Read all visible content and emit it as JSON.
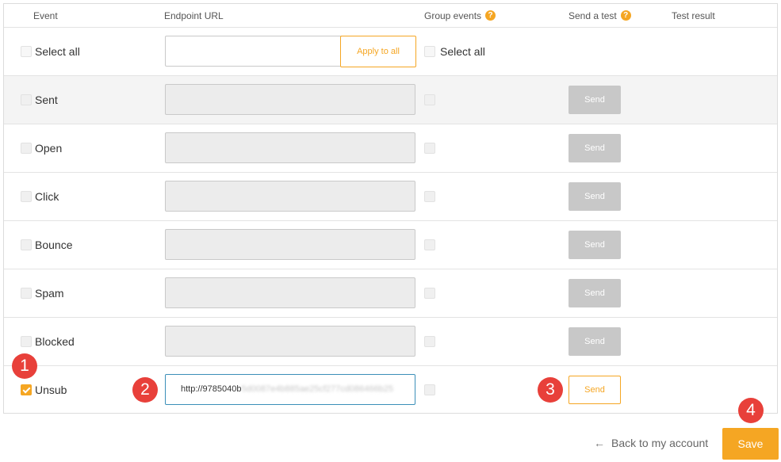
{
  "header": {
    "event": "Event",
    "endpoint_url": "Endpoint URL",
    "group_events": "Group events",
    "send_test": "Send a test",
    "test_result": "Test result",
    "help_glyph": "?"
  },
  "select_all_row": {
    "label": "Select all",
    "url_value": "",
    "apply_label": "Apply to all",
    "group_label": "Select all"
  },
  "rows": [
    {
      "label": "Sent",
      "checked": false,
      "url": "",
      "send_label": "Send"
    },
    {
      "label": "Open",
      "checked": false,
      "url": "",
      "send_label": "Send"
    },
    {
      "label": "Click",
      "checked": false,
      "url": "",
      "send_label": "Send"
    },
    {
      "label": "Bounce",
      "checked": false,
      "url": "",
      "send_label": "Send"
    },
    {
      "label": "Spam",
      "checked": false,
      "url": "",
      "send_label": "Send"
    },
    {
      "label": "Blocked",
      "checked": false,
      "url": "",
      "send_label": "Send"
    },
    {
      "label": "Unsub",
      "checked": true,
      "url_visible": "http://9785040b",
      "url_obscured": "5d0087e4b885ae25cf277cd086466b25",
      "send_label": "Send"
    }
  ],
  "markers": [
    "1",
    "2",
    "3",
    "4"
  ],
  "footer": {
    "back_label": "Back to my account",
    "back_icon": "arrow-left-icon",
    "save_label": "Save"
  },
  "colors": {
    "accent": "#f5a623",
    "marker": "#e8403a",
    "disabled_button": "#c8c8c8",
    "active_input_border": "#3b8fb8"
  }
}
